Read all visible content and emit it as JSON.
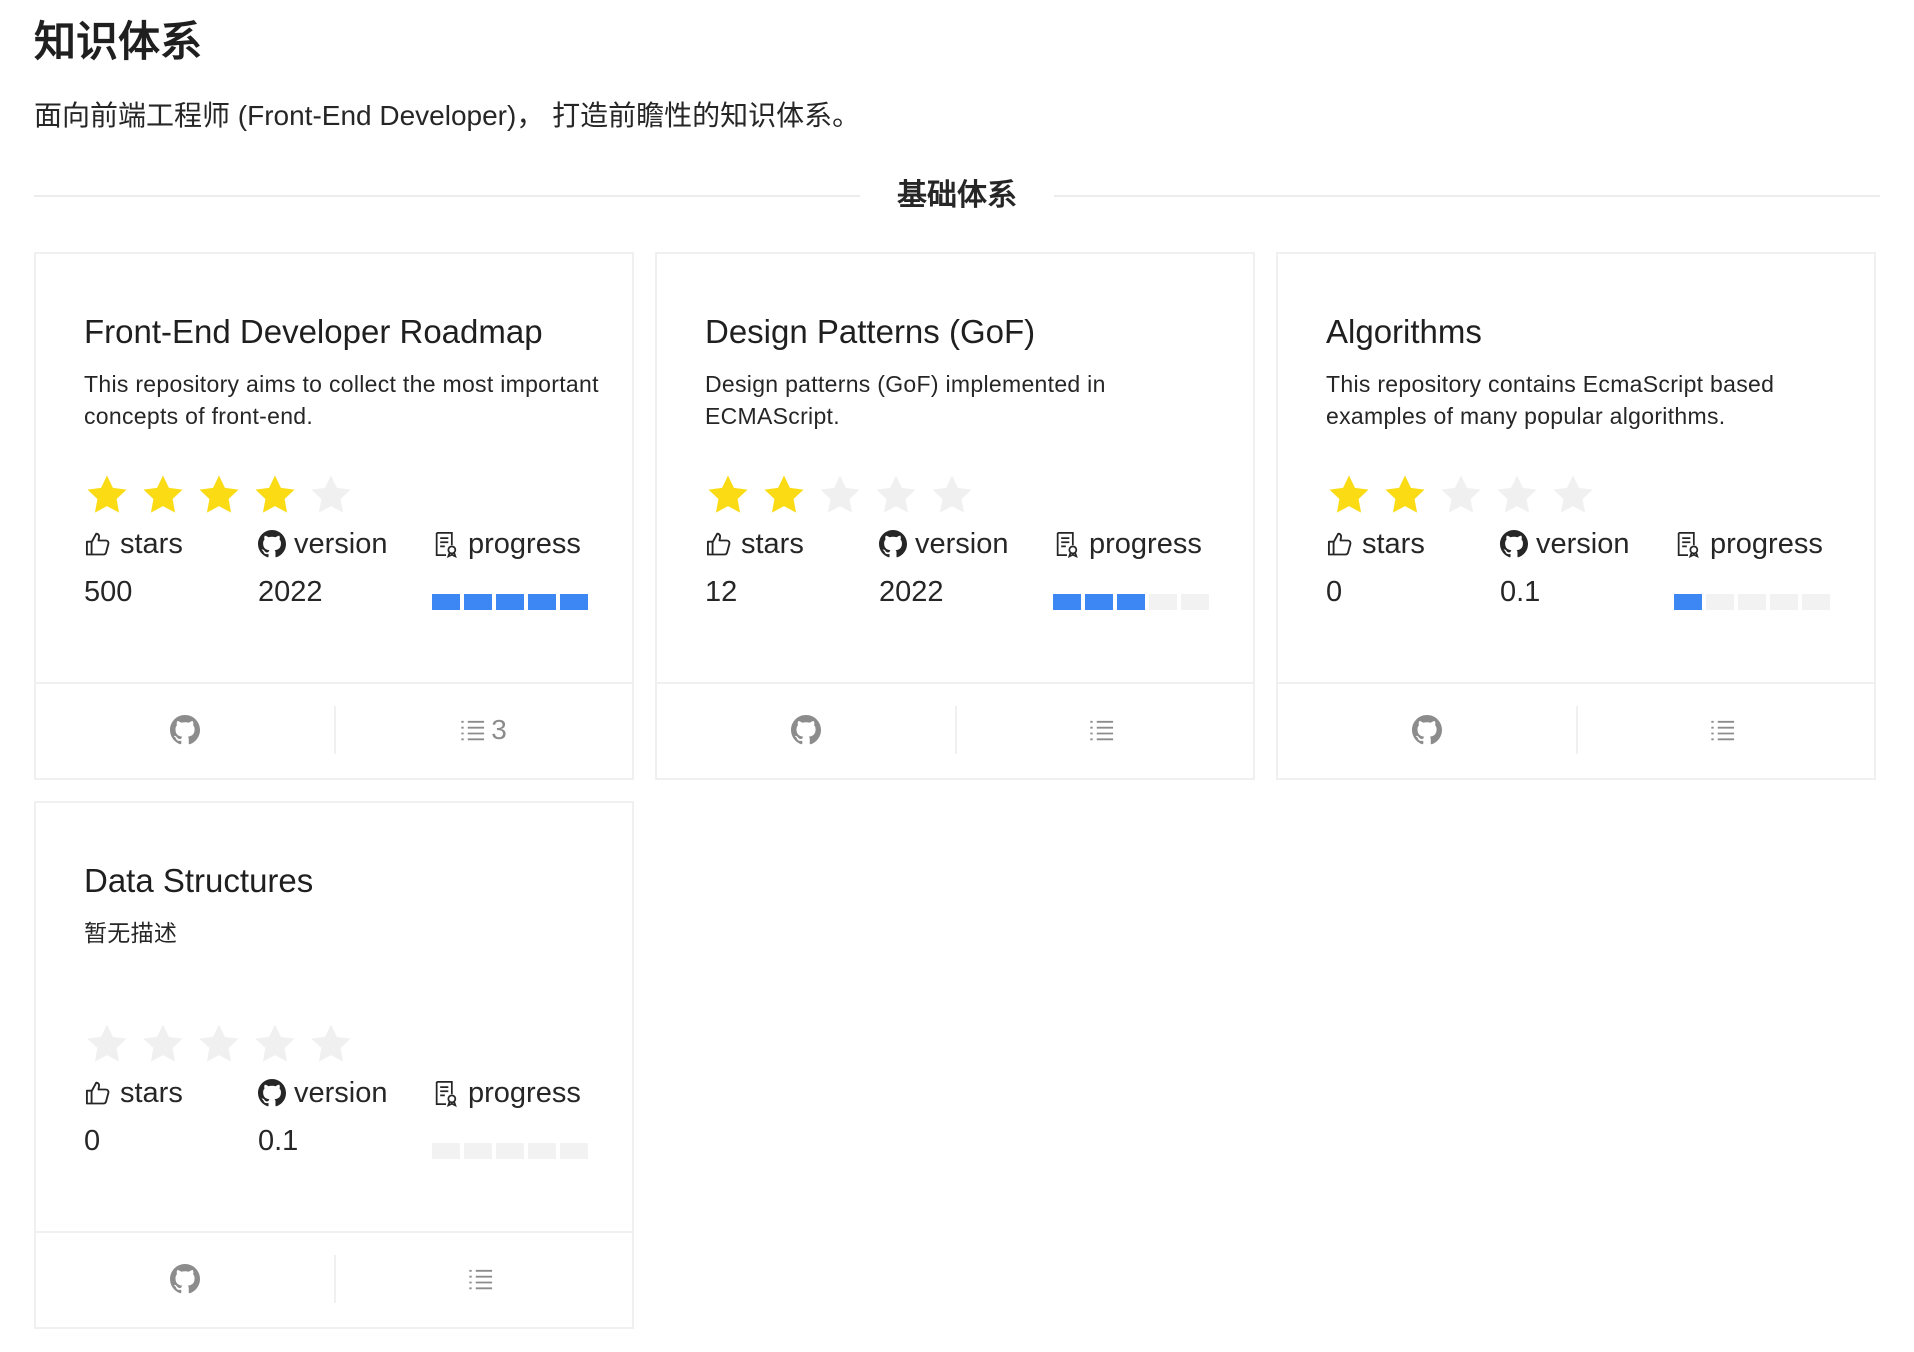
{
  "page": {
    "title": "知识体系",
    "description": "面向前端工程师 (Front-End Developer)， 打造前瞻性的知识体系。",
    "section_title": "基础体系"
  },
  "colors": {
    "star_on": "#fadb14",
    "star_off": "#f0f0f0",
    "progress_on": "#3d87f5",
    "progress_off": "#f2f2f2"
  },
  "labels": {
    "stars": "stars",
    "version": "version",
    "progress": "progress"
  },
  "icons": {
    "like": "like-icon",
    "github": "github-icon",
    "progress": "document-icon",
    "list": "list-icon",
    "star": "star-icon"
  },
  "cards": [
    {
      "title": "Front-End Developer Roadmap",
      "description": "This repository aims to collect the most important concepts of front-end.",
      "rating": 4,
      "rating_max": 5,
      "stars": "500",
      "version": "2022",
      "progress": 5,
      "progress_max": 5,
      "list_count": "3"
    },
    {
      "title": "Design Patterns (GoF)",
      "description": "Design patterns (GoF) implemented in ECMAScript.",
      "rating": 2,
      "rating_max": 5,
      "stars": "12",
      "version": "2022",
      "progress": 3,
      "progress_max": 5,
      "list_count": ""
    },
    {
      "title": "Algorithms",
      "description": "This repository contains EcmaScript based examples of many popular algorithms.",
      "rating": 2,
      "rating_max": 5,
      "stars": "0",
      "version": "0.1",
      "progress": 1,
      "progress_max": 5,
      "list_count": ""
    },
    {
      "title": "Data Structures",
      "description": "暂无描述",
      "rating": 0,
      "rating_max": 5,
      "stars": "0",
      "version": "0.1",
      "progress": 0,
      "progress_max": 5,
      "list_count": ""
    }
  ]
}
